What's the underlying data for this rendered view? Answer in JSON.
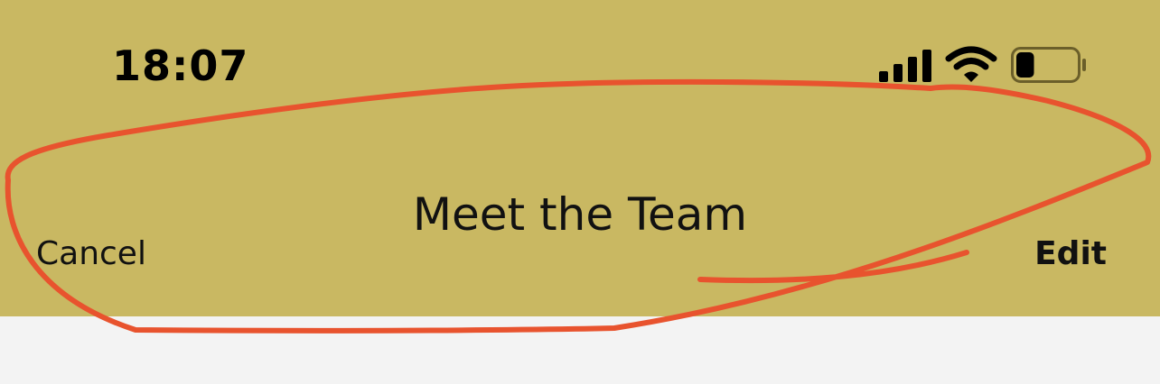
{
  "colors": {
    "header_background": "#c9b862",
    "content_background": "#f3f3f3",
    "annotation_stroke": "#e8532e"
  },
  "status_bar": {
    "time": "18:07",
    "signal_icon": "cellular-signal-icon",
    "wifi_icon": "wifi-icon",
    "battery_icon": "battery-icon",
    "battery_level": 0.3
  },
  "nav_bar": {
    "title": "Meet the Team",
    "left_button": "Cancel",
    "right_button": "Edit"
  },
  "annotation": {
    "type": "hand-drawn-loop",
    "encircles": "nav_bar"
  }
}
